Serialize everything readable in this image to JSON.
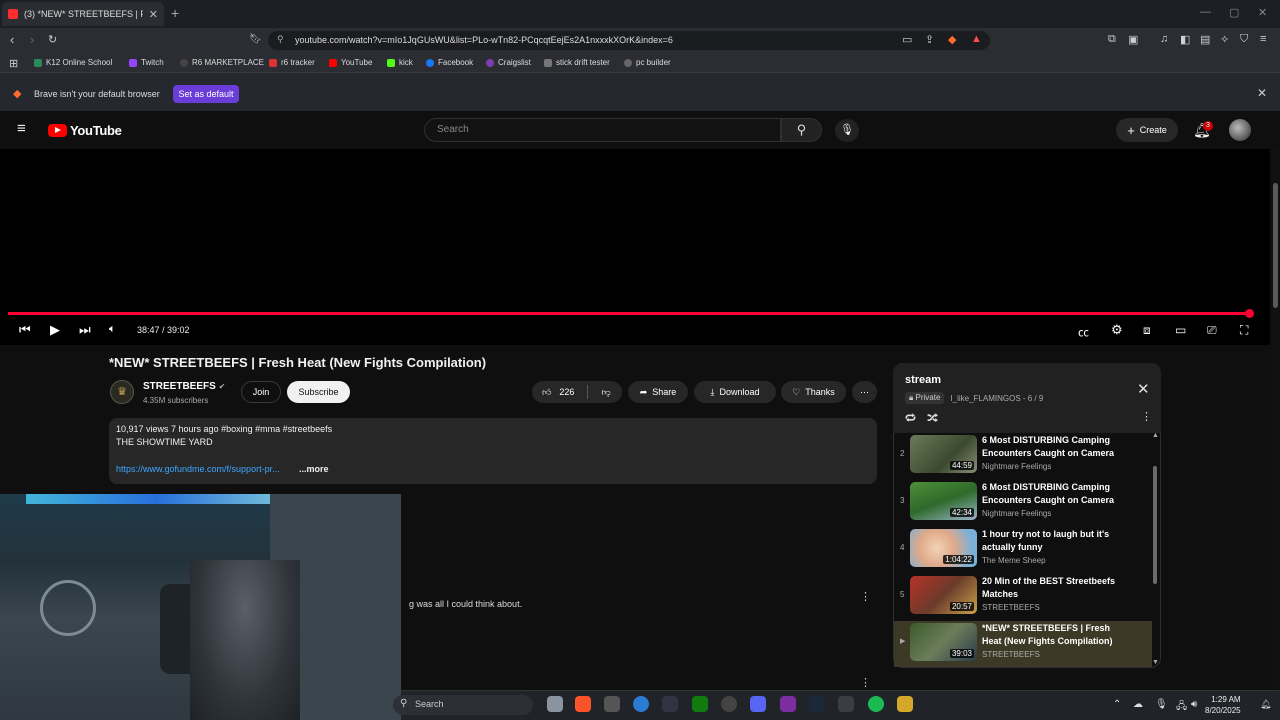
{
  "browser": {
    "tab_title": "(3) *NEW* STREETBEEFS | Fresh H",
    "url": "youtube.com/watch?v=mIo1JqGUsWU&list=PLo-wTn82-PCqcqtEejEs2A1nxxxkXOrK&index=6",
    "bookmarks": [
      "K12 Online School",
      "Twitch",
      "R6 MARKETPLACE",
      "r6 tracker",
      "YouTube",
      "kick",
      "Facebook",
      "Craigslist",
      "stick drift tester",
      "pc builder"
    ],
    "infobar_text": "Brave isn't your default browser",
    "infobar_button": "Set as default"
  },
  "youtube": {
    "logo_text": "YouTube",
    "search_placeholder": "Search",
    "create_label": "Create",
    "notification_count": "3"
  },
  "player": {
    "time": "38:47 / 39:02",
    "progress_fraction": 0.994
  },
  "video": {
    "title": "*NEW* STREETBEEFS | Fresh Heat (New Fights Compilation)",
    "channel_name": "STREETBEEFS",
    "subscribers": "4.35M subscribers",
    "join_label": "Join",
    "subscribe_label": "Subscribe",
    "likes": "226",
    "share_label": "Share",
    "download_label": "Download",
    "thanks_label": "Thanks",
    "desc_line1": "10,917 views  7 hours ago  #boxing #mma #streetbeefs",
    "desc_line2": "THE SHOWTIME YARD",
    "desc_link": "https://www.gofundme.com/f/support-pr...",
    "desc_more": "...more",
    "comment_text": "g was all I could think about."
  },
  "playlist": {
    "title": "stream",
    "privacy": "Private",
    "owner_position": "I_like_FLAMINGOS - 6 / 9",
    "items": [
      {
        "num": "2",
        "title": "6 Most DISTURBING Camping Encounters Caught on Camera",
        "channel": "Nightmare Feelings",
        "duration": "44:59"
      },
      {
        "num": "3",
        "title": "6 Most DISTURBING Camping Encounters Caught on Camera",
        "channel": "Nightmare Feelings",
        "duration": "42:34"
      },
      {
        "num": "4",
        "title": "1 hour try not to laugh but it's actually funny",
        "channel": "The Meme Sheep",
        "duration": "1:04:22"
      },
      {
        "num": "5",
        "title": "20 Min of the BEST Streetbeefs Matches",
        "channel": "STREETBEEFS",
        "duration": "20:57"
      },
      {
        "num": "▶",
        "title": "*NEW* STREETBEEFS | Fresh Heat (New Fights Compilation)",
        "channel": "STREETBEEFS",
        "duration": "39:03"
      }
    ]
  },
  "taskbar": {
    "search_label": "Search",
    "time": "1:29 AM",
    "date": "8/20/2025"
  },
  "colors": {
    "accent_red": "#ff0033",
    "brave_purple": "#6a3cd8",
    "link_blue": "#3ea6ff"
  }
}
